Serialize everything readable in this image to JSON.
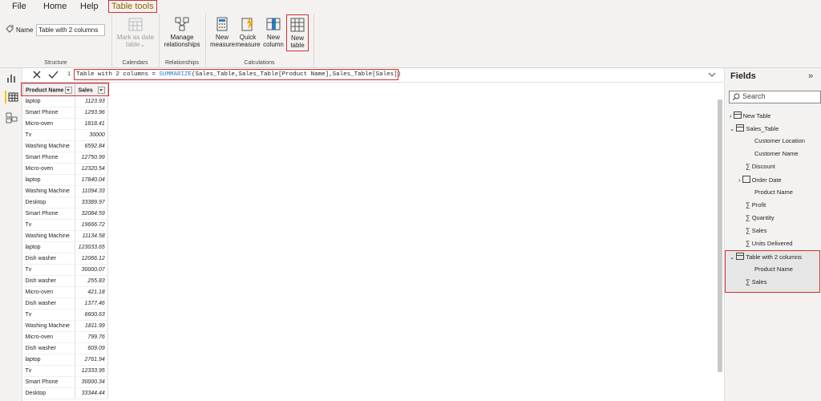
{
  "menu": {
    "file": "File",
    "home": "Home",
    "help": "Help",
    "table_tools": "Table tools"
  },
  "ribbon": {
    "name_label": "Name",
    "name_value": "Table with 2 columns",
    "groups": {
      "structure": "Structure",
      "calendars": "Calendars",
      "relationships": "Relationships",
      "calculations": "Calculations"
    },
    "mark_as_date_1": "Mark as date",
    "mark_as_date_2": "table",
    "manage_1": "Manage",
    "manage_2": "relationships",
    "new_measure_1": "New",
    "new_measure_2": "measure",
    "quick_measure_1": "Quick",
    "quick_measure_2": "measure",
    "new_column_1": "New",
    "new_column_2": "column",
    "new_table_1": "New",
    "new_table_2": "table"
  },
  "formula": {
    "line": "1",
    "prefix": "Table with 2 columns = ",
    "func": "SUMMARIZE",
    "args": "(Sales_Table,Sales_Table[Product Name],Sales_Table[Sales])"
  },
  "table": {
    "headers": [
      "Product Name",
      "Sales"
    ],
    "rows": [
      [
        "laptop",
        "1123.93"
      ],
      [
        "Smart Phone",
        "1293.96"
      ],
      [
        "Micro-oven",
        "1818.41"
      ],
      [
        "Tv",
        "30000"
      ],
      [
        "Washing Machine",
        "6592.84"
      ],
      [
        "Smart Phone",
        "12750.99"
      ],
      [
        "Micro-oven",
        "12320.54"
      ],
      [
        "laptop",
        "17840.04"
      ],
      [
        "Washing Machine",
        "11094.33"
      ],
      [
        "Desktop",
        "33389.97"
      ],
      [
        "Smart Phone",
        "32084.59"
      ],
      [
        "Tv",
        "19666.72"
      ],
      [
        "Washing Machine",
        "11134.58"
      ],
      [
        "laptop",
        "123033.65"
      ],
      [
        "Dish washer",
        "12066.12"
      ],
      [
        "Tv",
        "30000.07"
      ],
      [
        "Dish washer",
        "255.83"
      ],
      [
        "Micro-oven",
        "421.18"
      ],
      [
        "Dish washer",
        "1377.46"
      ],
      [
        "Tv",
        "6600.63"
      ],
      [
        "Washing Machine",
        "1811.99"
      ],
      [
        "Micro-oven",
        "799.76"
      ],
      [
        "Dish washer",
        "609.09"
      ],
      [
        "laptop",
        "2761.94"
      ],
      [
        "Tv",
        "12333.95"
      ],
      [
        "Smart Phone",
        "30000.34"
      ],
      [
        "Desktop",
        "33344.44"
      ]
    ]
  },
  "fields": {
    "title": "Fields",
    "search_placeholder": "Search",
    "new_table": "New Table",
    "sales_table": "Sales_Table",
    "sales_cols": [
      "Customer Location",
      "Customer Name",
      "Discount",
      "Order Date",
      "Product Name",
      "Profit",
      "Quantity",
      "Sales",
      "Units Delivered"
    ],
    "table2": "Table with 2 columns",
    "table2_cols": [
      "Product Name",
      "Sales"
    ]
  },
  "colors": {
    "accent": "#f2c811",
    "highlight": "#d32f2f",
    "dax_function": "#2d7cc4"
  }
}
